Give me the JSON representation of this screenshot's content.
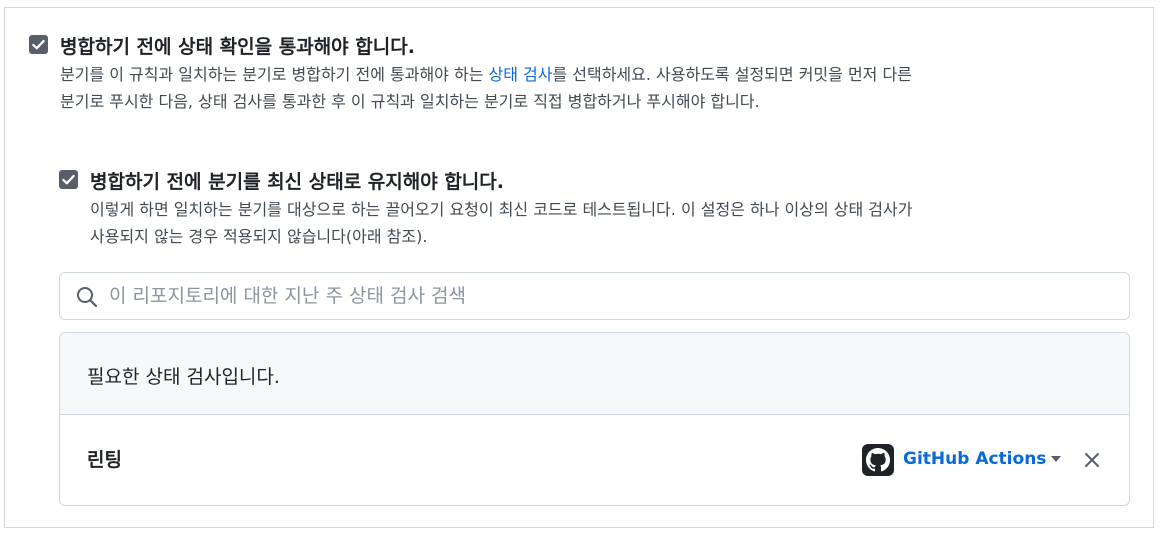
{
  "require_status_checks": {
    "checked": true,
    "title": "병합하기 전에 상태 확인을 통과해야 합니다.",
    "description_line1_pre": "분기를 이 규칙과 일치하는 분기로 병합하기 전에 통과해야 하는 ",
    "description_link": "상태 검사",
    "description_line1_post": "를 선택하세요. 사용하도록 설정되면 커밋을 먼저 다른",
    "description_line2": "분기로 푸시한 다음, 상태 검사를 통과한 후 이 규칙과 일치하는 분기로 직접 병합하거나 푸시해야 합니다."
  },
  "require_up_to_date": {
    "checked": true,
    "title": "병합하기 전에 분기를 최신 상태로 유지해야 합니다.",
    "description_line1": "이렇게 하면 일치하는 분기를 대상으로 하는 끌어오기 요청이 최신 코드로 테스트됩니다. 이 설정은 하나 이상의 상태 검사가",
    "description_line2": "사용되지 않는 경우 적용되지 않습니다(아래 참조)."
  },
  "search": {
    "placeholder": "이 리포지토리에 대한 지난 주 상태 검사 검색",
    "value": ""
  },
  "required_checks": {
    "header": "필요한 상태 검사입니다.",
    "items": [
      {
        "name": "린팅",
        "app": "GitHub Actions",
        "app_icon": "github-mark-icon"
      }
    ]
  },
  "colors": {
    "link": "#0969da",
    "checkbox": "#57606a",
    "border": "#d0d7de",
    "header_bg": "#f6f8fa"
  }
}
